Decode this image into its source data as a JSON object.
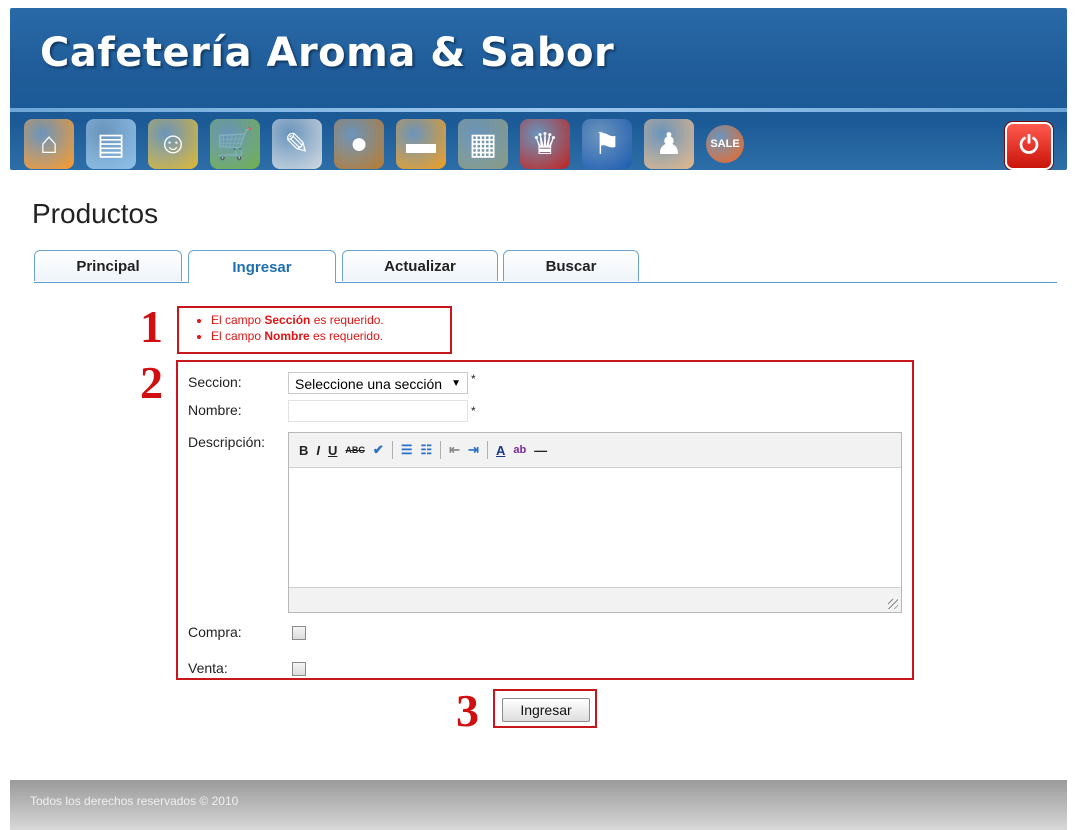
{
  "header": {
    "site_title": "Cafetería Aroma & Sabor",
    "icons": [
      {
        "name": "home-icon",
        "glyph": "⌂",
        "color": "#ff9a28"
      },
      {
        "name": "cash-register-icon",
        "glyph": "▤",
        "color": "#8ec0e8"
      },
      {
        "name": "people-icon",
        "glyph": "☺",
        "color": "#e0b830"
      },
      {
        "name": "shopping-cart-icon",
        "glyph": "🛒",
        "color": "#6fb04a"
      },
      {
        "name": "checklist-icon",
        "glyph": "✎",
        "color": "#d0d8e0"
      },
      {
        "name": "muffin-icon",
        "glyph": "●",
        "color": "#b9792a"
      },
      {
        "name": "truck-icon",
        "glyph": "▬",
        "color": "#f29e1c"
      },
      {
        "name": "cabinet-icon",
        "glyph": "▦",
        "color": "#8a9a80"
      },
      {
        "name": "samurai-mask-icon",
        "glyph": "♛",
        "color": "#c0201c"
      },
      {
        "name": "flag-icon",
        "glyph": "⚑",
        "color": "#1c5ab0"
      },
      {
        "name": "users-icon",
        "glyph": "♟",
        "color": "#e6b888"
      },
      {
        "name": "sale-icon",
        "glyph": "SALE",
        "color": "#f2651c"
      }
    ],
    "power_glyph": "⏻"
  },
  "page": {
    "title": "Productos"
  },
  "tabs": [
    {
      "label": "Principal"
    },
    {
      "label": "Ingresar"
    },
    {
      "label": "Actualizar"
    },
    {
      "label": "Buscar"
    }
  ],
  "annotations": [
    "1",
    "2",
    "3"
  ],
  "errors": {
    "items": [
      {
        "prefix": "El campo ",
        "field": "Sección",
        "suffix": " es requerido."
      },
      {
        "prefix": "El campo ",
        "field": "Nombre",
        "suffix": " es requerido."
      }
    ]
  },
  "form": {
    "seccion_label": "Seccion:",
    "seccion_value": "Seleccione una sección",
    "required_mark": "*",
    "nombre_label": "Nombre:",
    "nombre_value": "",
    "descripcion_label": "Descripción:",
    "compra_label": "Compra:",
    "venta_label": "Venta:",
    "submit_label": "Ingresar"
  },
  "editor_toolbar": {
    "bold": "B",
    "italic": "I",
    "underline": "U",
    "strike": "ABC",
    "spell": "✔",
    "bullets": "☰",
    "numbers": "☷",
    "outdent": "⇤",
    "indent": "⇥",
    "font_color": "A",
    "highlight": "ab",
    "hr": "—"
  },
  "footer": {
    "text": "Todos los derechos reservados © 2010"
  }
}
